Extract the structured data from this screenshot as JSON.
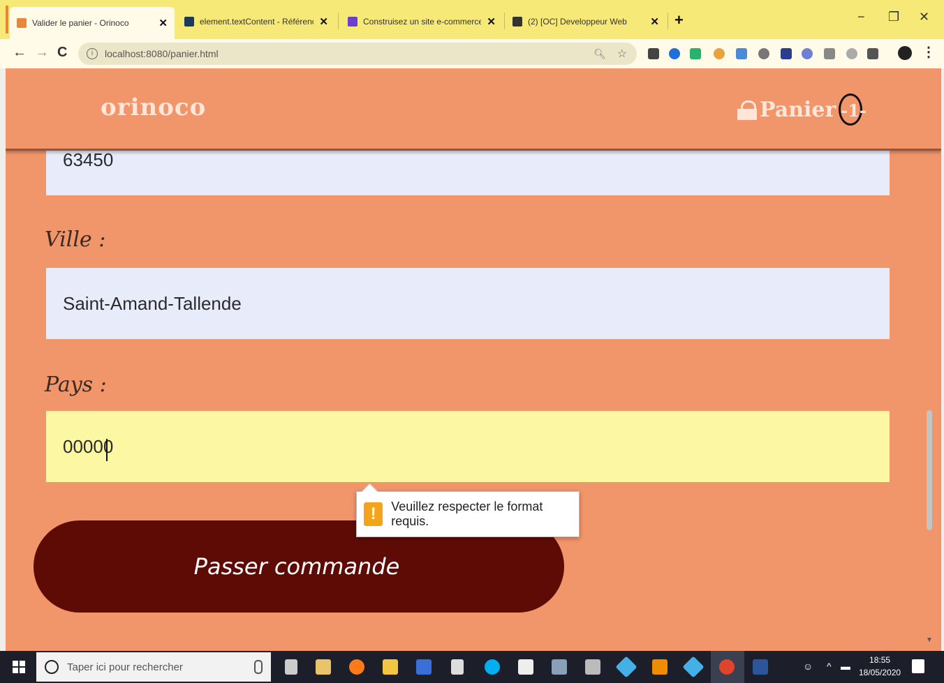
{
  "browser": {
    "tabs": [
      {
        "title": "Valider le panier - Orinoco",
        "favicon_color": "#e8873a",
        "active": true
      },
      {
        "title": "element.textContent - Référence",
        "favicon_color": "#1a3a5e",
        "active": false
      },
      {
        "title": "Construisez un site e-commerce",
        "favicon_color": "#6c3fd1",
        "active": false
      },
      {
        "title": "(2) [OC] Developpeur Web",
        "favicon_color": "#333333",
        "active": false
      }
    ],
    "new_tab": "+",
    "url": "localhost:8080/panier.html",
    "window": {
      "minimize": "−",
      "maximize": "❐",
      "close": "✕"
    }
  },
  "header": {
    "brand": "orinoco",
    "cart_label": "Panier",
    "cart_count": "-1-"
  },
  "form": {
    "postal_code_value": "63450",
    "city_label": "Ville :",
    "city_value": "Saint-Amand-Tallende",
    "country_label": "Pays :",
    "country_value": "00000"
  },
  "validation": {
    "message": "Veuillez respecter le format requis.",
    "icon": "!"
  },
  "order_button": "Passer commande",
  "taskbar": {
    "search_placeholder": "Taper ici pour rechercher",
    "time": "18:55",
    "date": "18/05/2020"
  },
  "colors": {
    "page_bg": "#f1956b",
    "button_bg": "#5e0b06",
    "invalid_field": "#fbf7a2",
    "field_bg": "#e8ecfa"
  }
}
